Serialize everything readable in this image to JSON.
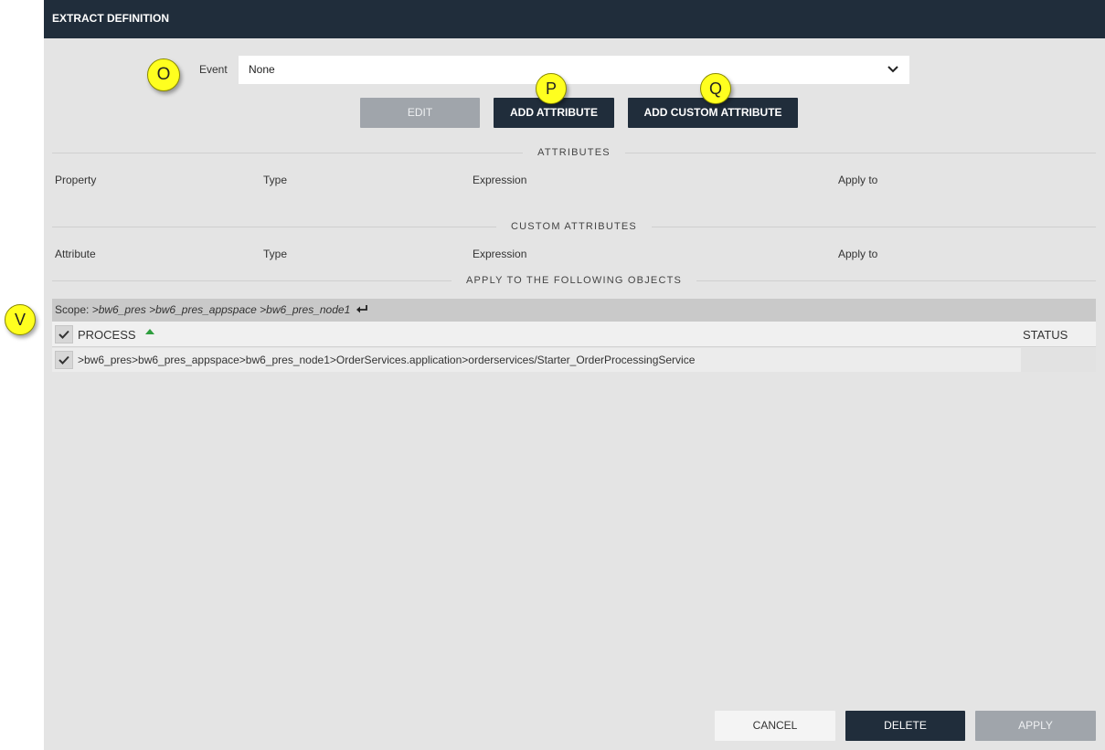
{
  "titlebar": {
    "title": "EXTRACT DEFINITION"
  },
  "event": {
    "label": "Event",
    "value": "None"
  },
  "buttons": {
    "edit": "EDIT",
    "add_attribute": "ADD ATTRIBUTE",
    "add_custom_attribute": "ADD CUSTOM ATTRIBUTE",
    "cancel": "CANCEL",
    "delete": "DELETE",
    "apply": "APPLY"
  },
  "attributes": {
    "title": "ATTRIBUTES",
    "columns": [
      "Property",
      "Type",
      "Expression",
      "Apply to"
    ]
  },
  "custom_attributes": {
    "title": "CUSTOM ATTRIBUTES",
    "columns": [
      "Attribute",
      "Type",
      "Expression",
      "Apply to"
    ]
  },
  "objects": {
    "title": "APPLY TO THE FOLLOWING OBJECTS",
    "scope_label": "Scope:",
    "scope_path": ">bw6_pres >bw6_pres_appspace >bw6_pres_node1",
    "header": {
      "process": "PROCESS",
      "status": "STATUS"
    },
    "rows": [
      {
        "process": ">bw6_pres>bw6_pres_appspace>bw6_pres_node1>OrderServices.application>orderservices/Starter_OrderProcessingService",
        "status": ""
      }
    ]
  },
  "markers": {
    "o": "O",
    "p": "P",
    "q": "Q",
    "v": "V"
  },
  "colors": {
    "titlebar": "#202d3b",
    "panel": "#e4e4e4",
    "button_dark": "#202d3b",
    "button_disabled": "#a0a5ab",
    "sort_arrow": "#2e9e3e",
    "marker": "#ffff1f"
  },
  "icons": {
    "dropdown": "chevron-down-icon",
    "scope_return": "return-arrow-icon",
    "sort": "sort-ascending-icon",
    "checkbox": "checkmark-icon"
  }
}
